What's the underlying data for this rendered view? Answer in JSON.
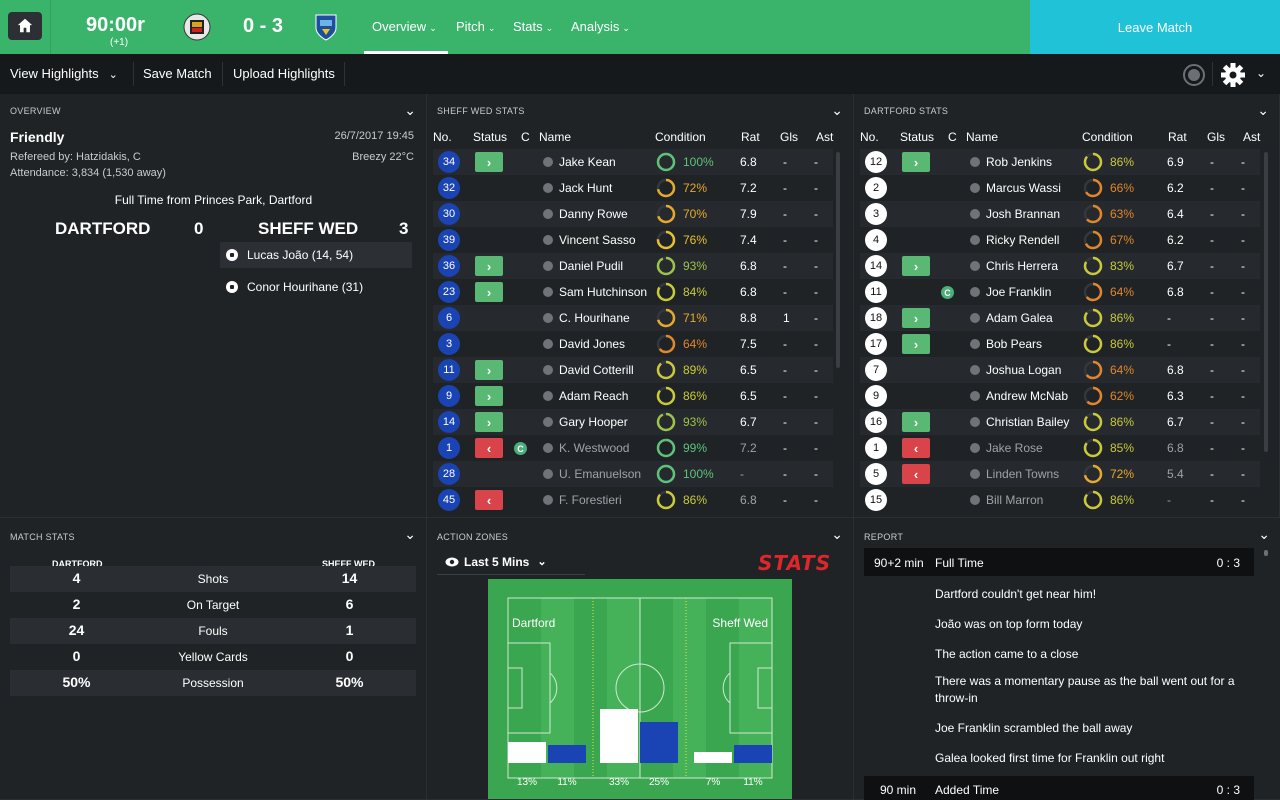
{
  "header": {
    "clock": "90:00r",
    "added_time": "(+1)",
    "score": "0 - 3",
    "nav": [
      "Overview",
      "Pitch",
      "Stats",
      "Analysis"
    ],
    "leave": "Leave Match",
    "accent": "#3bb46b",
    "leave_color": "#1fc2d6"
  },
  "toolbar": {
    "view_highlights": "View Highlights",
    "save_match": "Save Match",
    "upload_highlights": "Upload Highlights"
  },
  "overview": {
    "title": "OVERVIEW",
    "match_type": "Friendly",
    "date": "26/7/2017 19:45",
    "referee": "Refereed by: Hatzidakis, C",
    "weather": "Breezy 22°C",
    "attendance": "Attendance: 3,834 (1,530 away)",
    "ft_text": "Full Time from Princes Park, Dartford",
    "home_team": "DARTFORD",
    "home_score": "0",
    "away_team": "SHEFF WED",
    "away_score": "3",
    "scorers": [
      "Lucas João (14, 54)",
      "Conor Hourihane (31)"
    ]
  },
  "sw_stats": {
    "title": "SHEFF WED STATS",
    "cols": [
      "No.",
      "Status",
      "C",
      "Name",
      "Condition",
      "Rat",
      "Gls",
      "Ast"
    ],
    "rows": [
      {
        "no": "34",
        "status": "in",
        "c": "",
        "name": "Jake Kean",
        "cond": "100%",
        "ccol": "#5ec27a",
        "pct": 100,
        "rat": "6.8",
        "gls": "-",
        "ast": "-",
        "dim": false
      },
      {
        "no": "32",
        "status": "",
        "c": "",
        "name": "Jack Hunt",
        "cond": "72%",
        "ccol": "#e7a92c",
        "pct": 72,
        "rat": "7.2",
        "gls": "-",
        "ast": "-",
        "dim": false
      },
      {
        "no": "30",
        "status": "",
        "c": "",
        "name": "Danny Rowe",
        "cond": "70%",
        "ccol": "#e7a92c",
        "pct": 70,
        "rat": "7.9",
        "gls": "-",
        "ast": "-",
        "dim": false
      },
      {
        "no": "39",
        "status": "",
        "c": "",
        "name": "Vincent Sasso",
        "cond": "76%",
        "ccol": "#e7c02c",
        "pct": 76,
        "rat": "7.4",
        "gls": "-",
        "ast": "-",
        "dim": false
      },
      {
        "no": "36",
        "status": "in",
        "c": "",
        "name": "Daniel Pudil",
        "cond": "93%",
        "ccol": "#9fc24a",
        "pct": 93,
        "rat": "6.8",
        "gls": "-",
        "ast": "-",
        "dim": false
      },
      {
        "no": "23",
        "status": "in",
        "c": "",
        "name": "Sam Hutchinson",
        "cond": "84%",
        "ccol": "#c9c93a",
        "pct": 84,
        "rat": "6.8",
        "gls": "-",
        "ast": "-",
        "dim": false
      },
      {
        "no": "6",
        "status": "",
        "c": "",
        "name": "C. Hourihane",
        "cond": "71%",
        "ccol": "#e7a92c",
        "pct": 71,
        "rat": "8.8",
        "gls": "1",
        "ast": "-",
        "dim": false
      },
      {
        "no": "3",
        "status": "",
        "c": "",
        "name": "David Jones",
        "cond": "64%",
        "ccol": "#e0862c",
        "pct": 64,
        "rat": "7.5",
        "gls": "-",
        "ast": "-",
        "dim": false
      },
      {
        "no": "11",
        "status": "in",
        "c": "",
        "name": "David Cotterill",
        "cond": "89%",
        "ccol": "#c9c93a",
        "pct": 89,
        "rat": "6.5",
        "gls": "-",
        "ast": "-",
        "dim": false
      },
      {
        "no": "9",
        "status": "in",
        "c": "",
        "name": "Adam Reach",
        "cond": "86%",
        "ccol": "#c9c93a",
        "pct": 86,
        "rat": "6.5",
        "gls": "-",
        "ast": "-",
        "dim": false
      },
      {
        "no": "14",
        "status": "in",
        "c": "",
        "name": "Gary Hooper",
        "cond": "93%",
        "ccol": "#9fc24a",
        "pct": 93,
        "rat": "6.7",
        "gls": "-",
        "ast": "-",
        "dim": false
      },
      {
        "no": "1",
        "status": "out",
        "c": "C",
        "name": "K. Westwood",
        "cond": "99%",
        "ccol": "#5ec27a",
        "pct": 99,
        "rat": "7.2",
        "gls": "-",
        "ast": "-",
        "dim": true
      },
      {
        "no": "28",
        "status": "",
        "c": "",
        "name": "U. Emanuelson",
        "cond": "100%",
        "ccol": "#5ec27a",
        "pct": 100,
        "rat": "-",
        "gls": "-",
        "ast": "-",
        "dim": true
      },
      {
        "no": "45",
        "status": "out",
        "c": "",
        "name": "F. Forestieri",
        "cond": "86%",
        "ccol": "#c9c93a",
        "pct": 86,
        "rat": "6.8",
        "gls": "-",
        "ast": "-",
        "dim": true
      }
    ]
  },
  "dt_stats": {
    "title": "DARTFORD STATS",
    "cols": [
      "No.",
      "Status",
      "C",
      "Name",
      "Condition",
      "Rat",
      "Gls",
      "Ast"
    ],
    "rows": [
      {
        "no": "12",
        "status": "in",
        "c": "",
        "name": "Rob Jenkins",
        "cond": "86%",
        "ccol": "#c9c93a",
        "pct": 86,
        "rat": "6.9",
        "gls": "-",
        "ast": "-",
        "dim": false
      },
      {
        "no": "2",
        "status": "",
        "c": "",
        "name": "Marcus Wassi",
        "cond": "66%",
        "ccol": "#e0862c",
        "pct": 66,
        "rat": "6.2",
        "gls": "-",
        "ast": "-",
        "dim": false
      },
      {
        "no": "3",
        "status": "",
        "c": "",
        "name": "Josh Brannan",
        "cond": "63%",
        "ccol": "#e0862c",
        "pct": 63,
        "rat": "6.4",
        "gls": "-",
        "ast": "-",
        "dim": false
      },
      {
        "no": "4",
        "status": "",
        "c": "",
        "name": "Ricky Rendell",
        "cond": "67%",
        "ccol": "#e0862c",
        "pct": 67,
        "rat": "6.2",
        "gls": "-",
        "ast": "-",
        "dim": false
      },
      {
        "no": "14",
        "status": "in",
        "c": "",
        "name": "Chris Herrera",
        "cond": "83%",
        "ccol": "#c9c93a",
        "pct": 83,
        "rat": "6.7",
        "gls": "-",
        "ast": "-",
        "dim": false
      },
      {
        "no": "11",
        "status": "",
        "c": "C",
        "name": "Joe Franklin",
        "cond": "64%",
        "ccol": "#e0862c",
        "pct": 64,
        "rat": "6.8",
        "gls": "-",
        "ast": "-",
        "dim": false
      },
      {
        "no": "18",
        "status": "in",
        "c": "",
        "name": "Adam Galea",
        "cond": "86%",
        "ccol": "#c9c93a",
        "pct": 86,
        "rat": "-",
        "gls": "-",
        "ast": "-",
        "dim": false
      },
      {
        "no": "17",
        "status": "in",
        "c": "",
        "name": "Bob Pears",
        "cond": "86%",
        "ccol": "#c9c93a",
        "pct": 86,
        "rat": "-",
        "gls": "-",
        "ast": "-",
        "dim": false
      },
      {
        "no": "7",
        "status": "",
        "c": "",
        "name": "Joshua Logan",
        "cond": "64%",
        "ccol": "#e0862c",
        "pct": 64,
        "rat": "6.8",
        "gls": "-",
        "ast": "-",
        "dim": false
      },
      {
        "no": "9",
        "status": "",
        "c": "",
        "name": "Andrew McNab",
        "cond": "62%",
        "ccol": "#e0862c",
        "pct": 62,
        "rat": "6.3",
        "gls": "-",
        "ast": "-",
        "dim": false
      },
      {
        "no": "16",
        "status": "in",
        "c": "",
        "name": "Christian Bailey",
        "cond": "86%",
        "ccol": "#c9c93a",
        "pct": 86,
        "rat": "6.7",
        "gls": "-",
        "ast": "-",
        "dim": false
      },
      {
        "no": "1",
        "status": "out",
        "c": "",
        "name": "Jake Rose",
        "cond": "85%",
        "ccol": "#c9c93a",
        "pct": 85,
        "rat": "6.8",
        "gls": "-",
        "ast": "-",
        "dim": true
      },
      {
        "no": "5",
        "status": "out",
        "c": "",
        "name": "Linden Towns",
        "cond": "72%",
        "ccol": "#e7a92c",
        "pct": 72,
        "rat": "5.4",
        "gls": "-",
        "ast": "-",
        "dim": true
      },
      {
        "no": "15",
        "status": "",
        "c": "",
        "name": "Bill Marron",
        "cond": "86%",
        "ccol": "#c9c93a",
        "pct": 86,
        "rat": "-",
        "gls": "-",
        "ast": "-",
        "dim": true
      }
    ]
  },
  "match_stats": {
    "title": "MATCH STATS",
    "home": "DARTFORD",
    "away": "SHEFF WED",
    "rows": [
      {
        "h": "4",
        "label": "Shots",
        "a": "14"
      },
      {
        "h": "2",
        "label": "On Target",
        "a": "6"
      },
      {
        "h": "24",
        "label": "Fouls",
        "a": "1"
      },
      {
        "h": "0",
        "label": "Yellow Cards",
        "a": "0"
      },
      {
        "h": "50%",
        "label": "Possession",
        "a": "50%"
      }
    ]
  },
  "action_zones": {
    "title": "ACTION ZONES",
    "filter": "Last 5 Mins",
    "logo": "STATS",
    "home": "Dartford",
    "away": "Sheff Wed",
    "zones": [
      {
        "h": 13,
        "a": 11,
        "hl": "13%",
        "al": "11%"
      },
      {
        "h": 33,
        "a": 25,
        "hl": "33%",
        "al": "25%"
      },
      {
        "h": 7,
        "a": 11,
        "hl": "7%",
        "al": "11%"
      }
    ]
  },
  "report": {
    "title": "REPORT",
    "blocks": [
      {
        "time": "90+2 min",
        "event": "Full Time",
        "score": "0 : 3"
      },
      {
        "time": "90 min",
        "event": "Added Time",
        "score": "0 : 3"
      }
    ],
    "lines": [
      "Dartford couldn't get near him!",
      "João was on top form today",
      "The action came to a close",
      "There was a momentary pause as the ball went out for a throw-in",
      "Joe Franklin scrambled the ball away",
      "Galea looked first time for Franklin out right"
    ]
  }
}
